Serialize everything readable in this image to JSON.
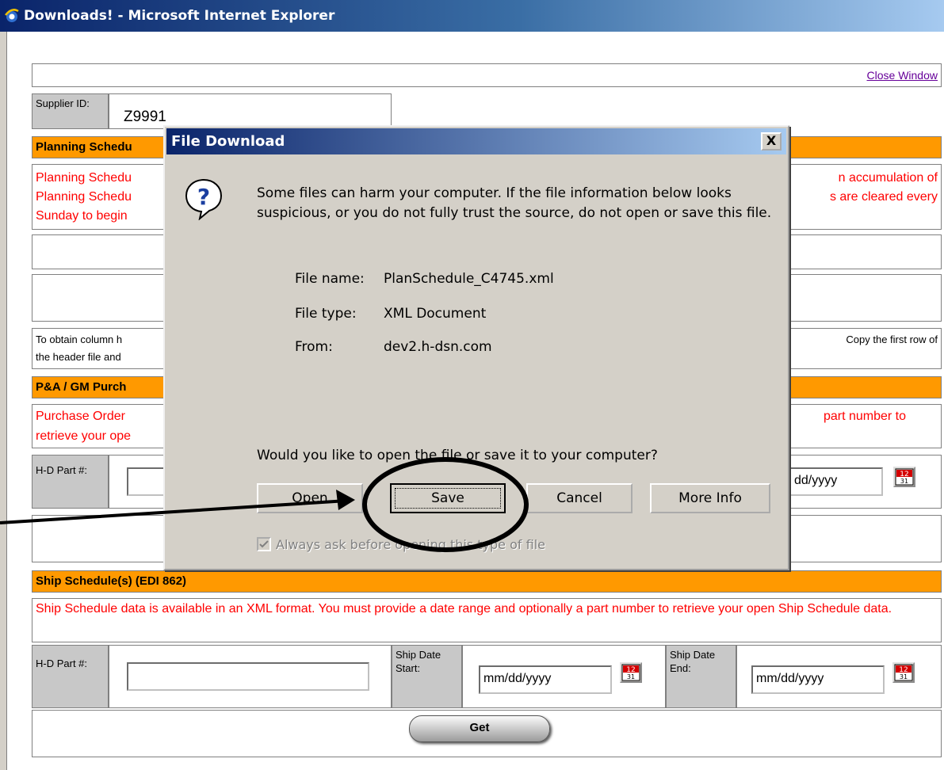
{
  "window": {
    "title": "Downloads! - Microsoft Internet Explorer"
  },
  "page": {
    "close_link": "Close Window",
    "supplier": {
      "label": "Supplier ID:",
      "value": "Z9991"
    },
    "planning": {
      "header": "Planning Schedu",
      "red_lines": [
        "Planning Schedu",
        "Planning Schedu",
        "Sunday to begin"
      ],
      "red_right": [
        "n accumulation of",
        "s are cleared every"
      ],
      "note_left": "To obtain column h",
      "note_left2": "the header file and",
      "note_right": "Copy the first row of"
    },
    "pa": {
      "header": "P&A / GM Purch",
      "red_left": [
        "Purchase Order",
        "retrieve your ope"
      ],
      "red_right": "part number to",
      "part_label": "H-D Part #:",
      "date_value": "dd/yyyy"
    },
    "ship": {
      "header": "Ship Schedule(s) (EDI 862)",
      "text": "Ship Schedule data is available in an XML format. You must provide a date range and optionally a part number to retrieve your open Ship Schedule data.",
      "part_label": "H-D Part #:",
      "start_label": "Ship Date Start:",
      "end_label": "Ship Date End:",
      "date_placeholder": "mm/dd/yyyy",
      "get_label": "Get"
    }
  },
  "dialog": {
    "title": "File Download",
    "close": "X",
    "warning": "Some files can harm your computer. If the file information below looks suspicious, or you do not fully trust the source, do not open or save this file.",
    "file_name_label": "File name:",
    "file_name": "PlanSchedule_C4745.xml",
    "file_type_label": "File type:",
    "file_type": "XML Document",
    "from_label": "From:",
    "from": "dev2.h-dsn.com",
    "question": "Would you like to open the file or save it to your computer?",
    "buttons": {
      "open": "Open",
      "save": "Save",
      "cancel": "Cancel",
      "more_info": "More Info"
    },
    "checkbox_label": "Always ask before opening this type of file",
    "checkbox_checked": true
  }
}
